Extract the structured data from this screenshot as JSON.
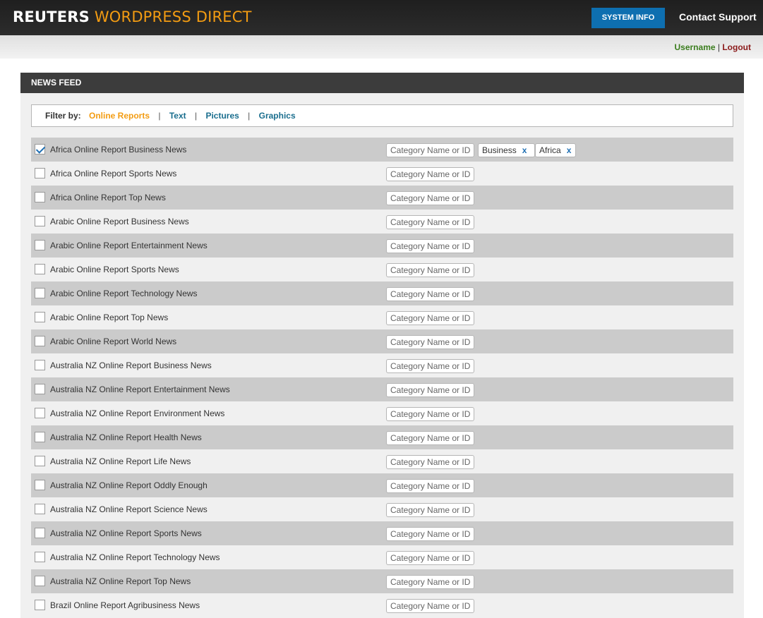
{
  "header": {
    "brand": "REUTERS",
    "product": "WORDPRESS DIRECT",
    "system_info_label": "SYSTEM INFO",
    "contact_label": "Contact Support"
  },
  "userbar": {
    "username": "Username",
    "separator": "|",
    "logout": "Logout"
  },
  "panel": {
    "title": "NEWS FEED"
  },
  "filter": {
    "label": "Filter by:",
    "options": [
      "Online Reports",
      "Text",
      "Pictures",
      "Graphics"
    ],
    "active": "Online Reports",
    "separator": "|"
  },
  "category_placeholder": "Category Name or ID",
  "tag_remove_glyph": "x",
  "feeds": [
    {
      "name": "Africa Online Report Business News",
      "checked": true,
      "tags": [
        "Business",
        "Africa"
      ]
    },
    {
      "name": "Africa Online Report Sports News",
      "checked": false,
      "tags": []
    },
    {
      "name": "Africa Online Report Top News",
      "checked": false,
      "tags": []
    },
    {
      "name": "Arabic Online Report Business News",
      "checked": false,
      "tags": []
    },
    {
      "name": "Arabic Online Report Entertainment News",
      "checked": false,
      "tags": []
    },
    {
      "name": "Arabic Online Report Sports News",
      "checked": false,
      "tags": []
    },
    {
      "name": "Arabic Online Report Technology News",
      "checked": false,
      "tags": []
    },
    {
      "name": "Arabic Online Report Top News",
      "checked": false,
      "tags": []
    },
    {
      "name": "Arabic Online Report World News",
      "checked": false,
      "tags": []
    },
    {
      "name": "Australia NZ Online Report Business News",
      "checked": false,
      "tags": []
    },
    {
      "name": "Australia NZ Online Report Entertainment News",
      "checked": false,
      "tags": []
    },
    {
      "name": "Australia NZ Online Report Environment News",
      "checked": false,
      "tags": []
    },
    {
      "name": "Australia NZ Online Report Health News",
      "checked": false,
      "tags": []
    },
    {
      "name": "Australia NZ Online Report Life News",
      "checked": false,
      "tags": []
    },
    {
      "name": "Australia NZ Online Report Oddly Enough",
      "checked": false,
      "tags": []
    },
    {
      "name": "Australia NZ Online Report Science News",
      "checked": false,
      "tags": []
    },
    {
      "name": "Australia NZ Online Report Sports News",
      "checked": false,
      "tags": []
    },
    {
      "name": "Australia NZ Online Report Technology News",
      "checked": false,
      "tags": []
    },
    {
      "name": "Australia NZ Online Report Top News",
      "checked": false,
      "tags": []
    },
    {
      "name": "Brazil Online Report Agribusiness News",
      "checked": false,
      "tags": []
    }
  ]
}
